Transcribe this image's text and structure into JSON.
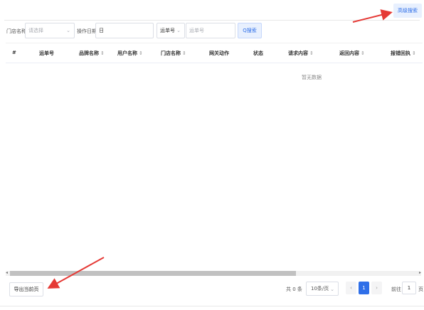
{
  "header": {
    "advanced_search": "高级搜索"
  },
  "filter": {
    "store_label": "门店名称:",
    "store_placeholder": "请选择",
    "date_label": "操作日期:",
    "date_value": "日",
    "waybill_select": "运单号",
    "waybill_placeholder": "运单号",
    "search_button": "Q搜索"
  },
  "table": {
    "columns": [
      {
        "label": "#",
        "sort": ""
      },
      {
        "label": "运单号",
        "sort": ""
      },
      {
        "label": "品牌名称",
        "sort": "⇕"
      },
      {
        "label": "用户名称",
        "sort": "⇕"
      },
      {
        "label": "门店名称",
        "sort": "⇕"
      },
      {
        "label": "网关动作",
        "sort": ""
      },
      {
        "label": "状态",
        "sort": ""
      },
      {
        "label": "请求内容",
        "sort": "⇕"
      },
      {
        "label": "返回内容",
        "sort": "⇕"
      },
      {
        "label": "报错回执",
        "sort": "⇕"
      }
    ],
    "empty_text": "暂无数据"
  },
  "footer": {
    "export_button": "导出当前页",
    "total": "共 0 条",
    "page_size": "10条/页",
    "prev": "‹",
    "current_page": "1",
    "next": "›",
    "goto_label": "前往",
    "goto_value": "1",
    "goto_unit": "页"
  },
  "colors": {
    "accent": "#2f6fe8",
    "annotation": "#e53935"
  },
  "icons": [
    "chevron-down-icon",
    "sort-icon",
    "scroll-left-icon",
    "scroll-right-icon",
    "annotation-arrow-icon"
  ]
}
